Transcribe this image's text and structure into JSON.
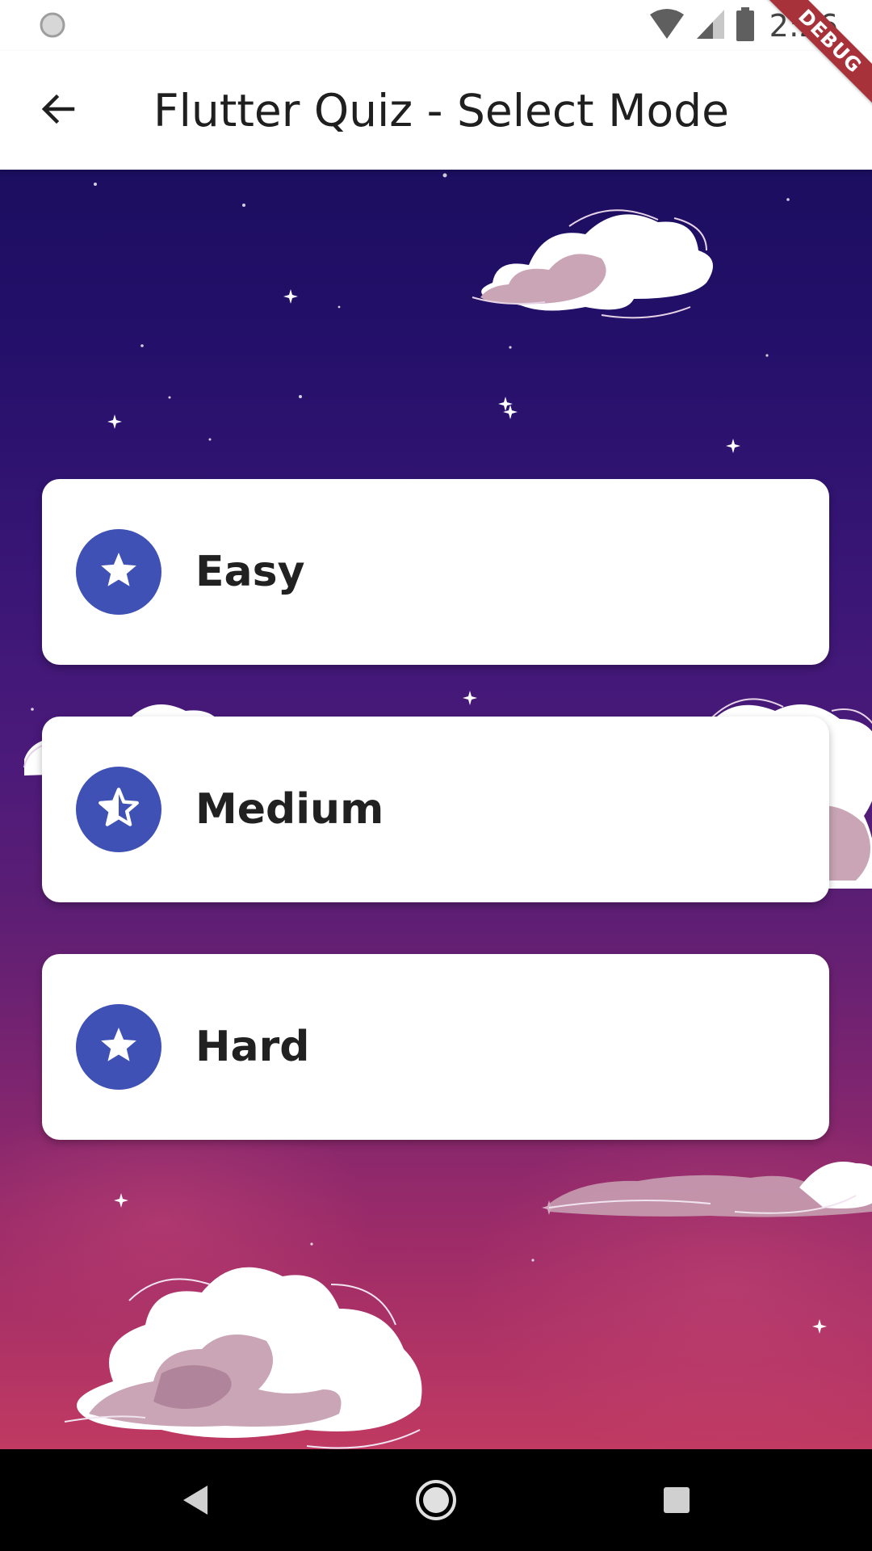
{
  "status_bar": {
    "time": "2:26",
    "icons": [
      "sync-icon",
      "wifi-icon",
      "cellular-signal-icon",
      "battery-icon"
    ]
  },
  "debug_banner": "DEBUG",
  "app_bar": {
    "title": "Flutter Quiz - Select Mode",
    "back_icon": "arrow-back-icon"
  },
  "modes": [
    {
      "label": "Easy",
      "icon": "star-icon"
    },
    {
      "label": "Medium",
      "icon": "star-half-icon"
    },
    {
      "label": "Hard",
      "icon": "star-icon"
    }
  ],
  "colors": {
    "accent": "#3f51b5",
    "card_text": "#212121",
    "sky_top": "#1c0e60",
    "sky_bottom": "#c03a62"
  },
  "nav_bar": {
    "icons": [
      "back-triangle-icon",
      "home-circle-icon",
      "recents-square-icon"
    ]
  }
}
